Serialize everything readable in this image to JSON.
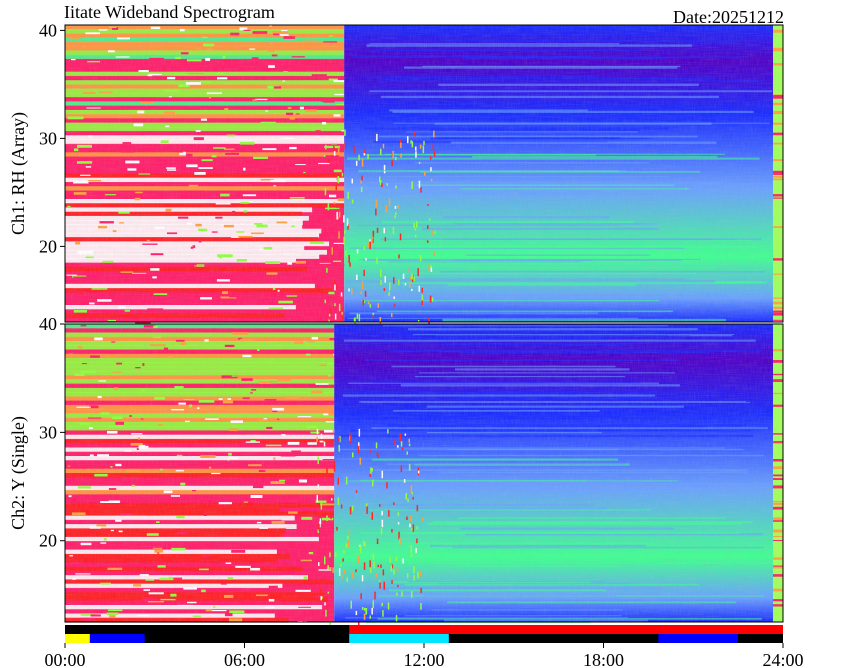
{
  "title": "Iitate Wideband Spectrogram",
  "date_label": "Date:20251212",
  "chart_data": [
    {
      "type": "heatmap",
      "channel": "Ch1",
      "ylabel": "Ch1: RH (Array)",
      "ylim": [
        13,
        40.5
      ],
      "yticks": [
        20,
        30,
        40
      ],
      "xlim": [
        "00:00",
        "24:00"
      ],
      "colormap": [
        "#ffffff",
        "#ff1f6a",
        "#ff2020",
        "#ffa040",
        "#90ff40",
        "#40ff90",
        "#6aa0ff",
        "#1a2cff",
        "#5000c8"
      ],
      "day_regime": {
        "start": "09:20",
        "end": "23:40",
        "description_colors": [
          "#1a2cff",
          "#5a3cd0",
          "#3ff070"
        ]
      }
    },
    {
      "type": "heatmap",
      "channel": "Ch2",
      "ylabel": "Ch2: Y (Single)",
      "ylim": [
        12.5,
        40
      ],
      "yticks": [
        20,
        30,
        40
      ],
      "xlim": [
        "00:00",
        "24:00"
      ],
      "colormap": [
        "#ffffff",
        "#ff1f6a",
        "#ff2020",
        "#ffa040",
        "#90ff40",
        "#40ff90",
        "#6aa0ff",
        "#1a2cff",
        "#5000c8"
      ],
      "day_regime": {
        "start": "09:00",
        "end": "23:40"
      }
    }
  ],
  "status_bar": {
    "segments": [
      {
        "start": "00:00",
        "end": "00:50",
        "color": "#ffff00"
      },
      {
        "start": "00:50",
        "end": "02:40",
        "color": "#0000ff"
      },
      {
        "start": "02:40",
        "end": "09:30",
        "color": "#000000"
      },
      {
        "start": "09:30",
        "end": "12:50",
        "color": "#00e5ff"
      },
      {
        "start": "12:50",
        "end": "19:50",
        "color": "#000000"
      },
      {
        "start": "19:50",
        "end": "22:30",
        "color": "#0000ff"
      },
      {
        "start": "22:30",
        "end": "24:00",
        "color": "#000000"
      }
    ],
    "top_line": [
      {
        "start": "09:30",
        "end": "24:00",
        "color": "#ff0000"
      }
    ]
  },
  "x_ticks": [
    "00:00",
    "06:00",
    "12:00",
    "18:00",
    "24:00"
  ]
}
